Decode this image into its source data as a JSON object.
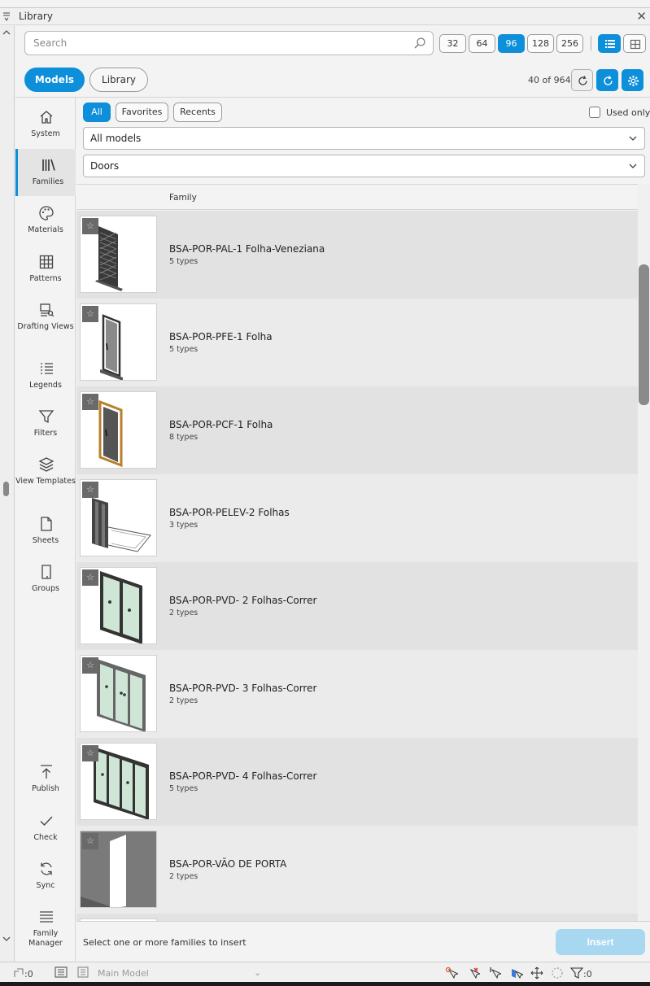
{
  "window": {
    "title": "Library"
  },
  "search": {
    "placeholder": "Search"
  },
  "sizes": [
    {
      "label": "32",
      "active": false
    },
    {
      "label": "64",
      "active": false
    },
    {
      "label": "96",
      "active": true
    },
    {
      "label": "128",
      "active": false
    },
    {
      "label": "256",
      "active": false
    }
  ],
  "tabs": {
    "models": "Models",
    "library": "Library"
  },
  "count_text": "40 of 964",
  "nav": [
    {
      "label": "System",
      "icon": "home-icon"
    },
    {
      "label": "Families",
      "icon": "books-icon",
      "active": true
    },
    {
      "label": "Materials",
      "icon": "palette-icon"
    },
    {
      "label": "Patterns",
      "icon": "grid-icon"
    },
    {
      "label": "Drafting Views",
      "icon": "drafting-view-icon"
    },
    {
      "label": "Legends",
      "icon": "list-icon"
    },
    {
      "label": "Filters",
      "icon": "funnel-icon"
    },
    {
      "label": "View Templates",
      "icon": "layers-icon"
    },
    {
      "label": "Sheets",
      "icon": "sheet-icon"
    },
    {
      "label": "Groups",
      "icon": "group-icon"
    }
  ],
  "nav_bottom": [
    {
      "label": "Publish",
      "icon": "publish-icon"
    },
    {
      "label": "Check",
      "icon": "check-icon"
    },
    {
      "label": "Sync",
      "icon": "sync-icon"
    },
    {
      "label": "Family Manager",
      "icon": "family-manager-icon"
    }
  ],
  "filters": {
    "all": "All",
    "favorites": "Favorites",
    "recents": "Recents",
    "used_only": "Used only"
  },
  "dropdowns": {
    "scope": "All models",
    "category": "Doors"
  },
  "list": {
    "column_family": "Family",
    "rows": [
      {
        "name": "BSA-POR-PAL-1 Folha-Veneziana",
        "types": "5 types",
        "thumb": "louver"
      },
      {
        "name": "BSA-POR-PFE-1 Folha",
        "types": "5 types",
        "thumb": "single-dark"
      },
      {
        "name": "BSA-POR-PCF-1 Folha",
        "types": "8 types",
        "thumb": "single-wood"
      },
      {
        "name": "BSA-POR-PELEV-2 Folhas",
        "types": "3 types",
        "thumb": "double-plan"
      },
      {
        "name": "BSA-POR-PVD- 2 Folhas-Correr",
        "types": "2 types",
        "thumb": "slide2"
      },
      {
        "name": "BSA-POR-PVD- 3 Folhas-Correr",
        "types": "2 types",
        "thumb": "slide3"
      },
      {
        "name": "BSA-POR-PVD- 4 Folhas-Correr",
        "types": "5 types",
        "thumb": "slide4"
      },
      {
        "name": "BSA-POR-VÃO DE PORTA",
        "types": "2 types",
        "thumb": "opening"
      }
    ]
  },
  "footer": {
    "hint": "Select one or more families to insert",
    "insert": "Insert"
  },
  "status": {
    "worksets": ":0",
    "model": "Main Model",
    "filter_count": ":0"
  },
  "colors": {
    "accent": "#0d8fd9",
    "insert_disabled": "#a8d7f0"
  }
}
